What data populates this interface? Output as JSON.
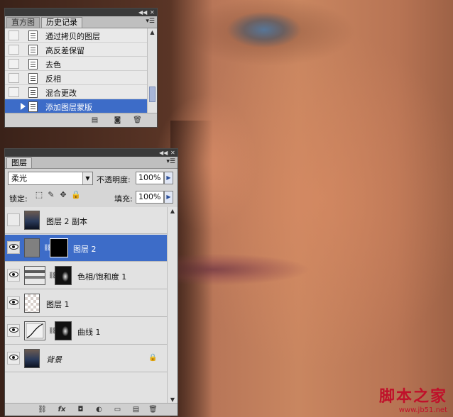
{
  "history_panel": {
    "tabs": [
      "直方图",
      "历史记录"
    ],
    "active_tab": 1,
    "items": [
      {
        "label": "通过拷贝的图层",
        "selected": false
      },
      {
        "label": "高反差保留",
        "selected": false
      },
      {
        "label": "去色",
        "selected": false
      },
      {
        "label": "反相",
        "selected": false
      },
      {
        "label": "混合更改",
        "selected": false
      },
      {
        "label": "添加图层蒙版",
        "selected": true
      }
    ]
  },
  "layers_panel": {
    "tab": "图层",
    "blend_mode": "柔光",
    "opacity_label": "不透明度:",
    "opacity_value": "100%",
    "lock_label": "锁定:",
    "fill_label": "填充:",
    "fill_value": "100%",
    "layers": [
      {
        "name": "图层 2 副本",
        "visible": false,
        "selected": false,
        "thumb": "portrait",
        "mask": false,
        "italic": false,
        "locked": false
      },
      {
        "name": "图层 2",
        "visible": true,
        "selected": true,
        "thumb": "gray",
        "mask": "black",
        "italic": false,
        "locked": false
      },
      {
        "name": "色相/饱和度 1",
        "visible": true,
        "selected": false,
        "thumb": "hue-sat",
        "mask": "face",
        "italic": false,
        "locked": false
      },
      {
        "name": "图层 1",
        "visible": true,
        "selected": false,
        "thumb": "transparent",
        "mask": false,
        "italic": false,
        "locked": false
      },
      {
        "name": "曲线 1",
        "visible": true,
        "selected": false,
        "thumb": "curves",
        "mask": "face",
        "italic": false,
        "locked": false
      },
      {
        "name": "背景",
        "visible": true,
        "selected": false,
        "thumb": "portrait",
        "mask": false,
        "italic": true,
        "locked": true
      }
    ]
  },
  "watermark": {
    "main": "脚本之家",
    "url": "www.jb51.net",
    "color": "#c0102a"
  },
  "colors": {
    "selection": "#3d6cc8"
  }
}
